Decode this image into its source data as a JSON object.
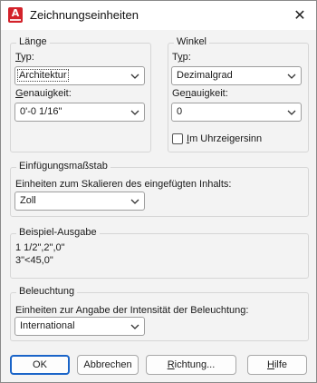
{
  "window": {
    "title": "Zeichnungseinheiten",
    "icon": "autocad-app-icon",
    "close_glyph": "✕",
    "icon_letter": "A"
  },
  "length": {
    "legend": "Länge",
    "type_label": "Typ:",
    "type_value": "Architektur",
    "precision_label": "Genauigkeit:",
    "precision_value": "0'-0 1/16\""
  },
  "angle": {
    "legend": "Winkel",
    "type_label": "Typ:",
    "type_value": "Dezimalgrad",
    "precision_label": "Genauigkeit:",
    "precision_value": "0",
    "clockwise_label": "Im Uhrzeigersinn",
    "clockwise_checked": false
  },
  "insertion": {
    "legend": "Einfügungsmaßstab",
    "desc": "Einheiten zum Skalieren des eingefügten Inhalts:",
    "value": "Zoll"
  },
  "sample": {
    "legend": "Beispiel-Ausgabe",
    "line1": "1 1/2\",2\",0\"",
    "line2": "3\"<45,0\""
  },
  "lighting": {
    "legend": "Beleuchtung",
    "desc": "Einheiten zur Angabe der Intensität der Beleuchtung:",
    "value": "International"
  },
  "buttons": {
    "ok": "OK",
    "cancel": "Abbrechen",
    "direction": "Richtung...",
    "help": "Hilfe"
  },
  "colors": {
    "accent": "#1a64c8",
    "app_icon": "#d3222a"
  }
}
